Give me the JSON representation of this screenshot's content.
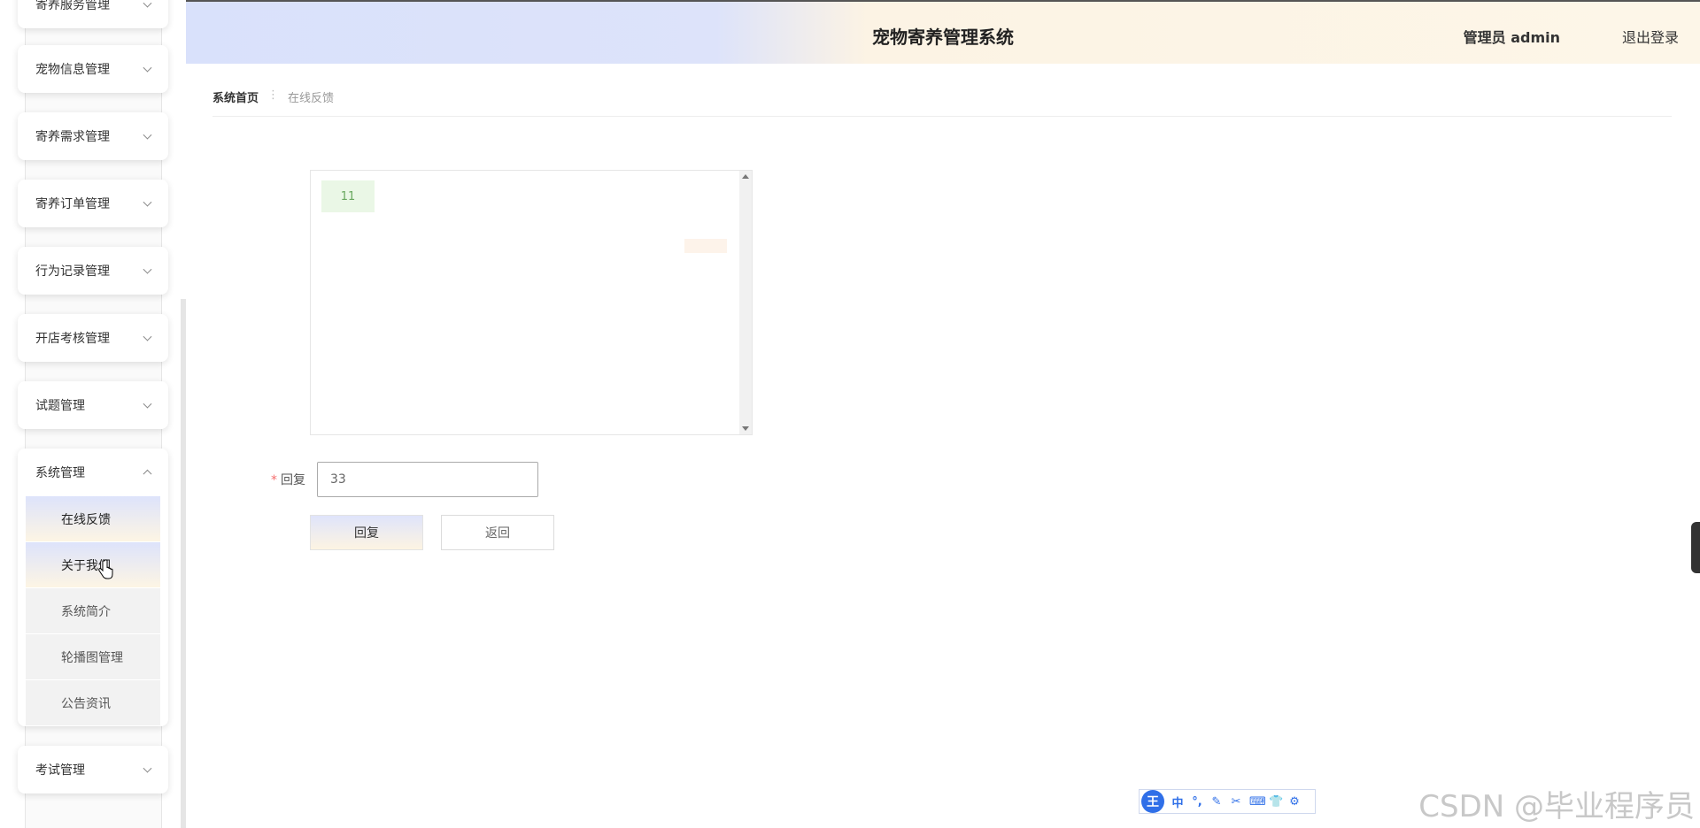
{
  "header": {
    "title": "宠物寄养管理系统",
    "user": "管理员 admin",
    "logout": "退出登录"
  },
  "sidebar": {
    "items": [
      {
        "label": "寄养服务管理"
      },
      {
        "label": "宠物信息管理"
      },
      {
        "label": "寄养需求管理"
      },
      {
        "label": "寄养订单管理"
      },
      {
        "label": "行为记录管理"
      },
      {
        "label": "开店考核管理"
      },
      {
        "label": "试题管理"
      }
    ],
    "system": {
      "label": "系统管理",
      "sub": [
        "在线反馈",
        "关于我们",
        "系统简介",
        "轮播图管理",
        "公告资讯"
      ]
    },
    "exam": {
      "label": "考试管理"
    }
  },
  "breadcrumb": {
    "home": "系统首页",
    "separator": "⋮",
    "current": "在线反馈"
  },
  "chat": {
    "messages": [
      "11"
    ]
  },
  "form": {
    "reply_label": "回复",
    "required_mark": "*",
    "reply_value": "33",
    "reply_button": "回复",
    "back_button": "返回"
  },
  "ime": {
    "logo": "王",
    "buttons": [
      "中",
      "°,",
      "✎",
      "✂",
      "⌨",
      "👕",
      "⚙"
    ]
  },
  "watermark": "CSDN @毕业程序员"
}
